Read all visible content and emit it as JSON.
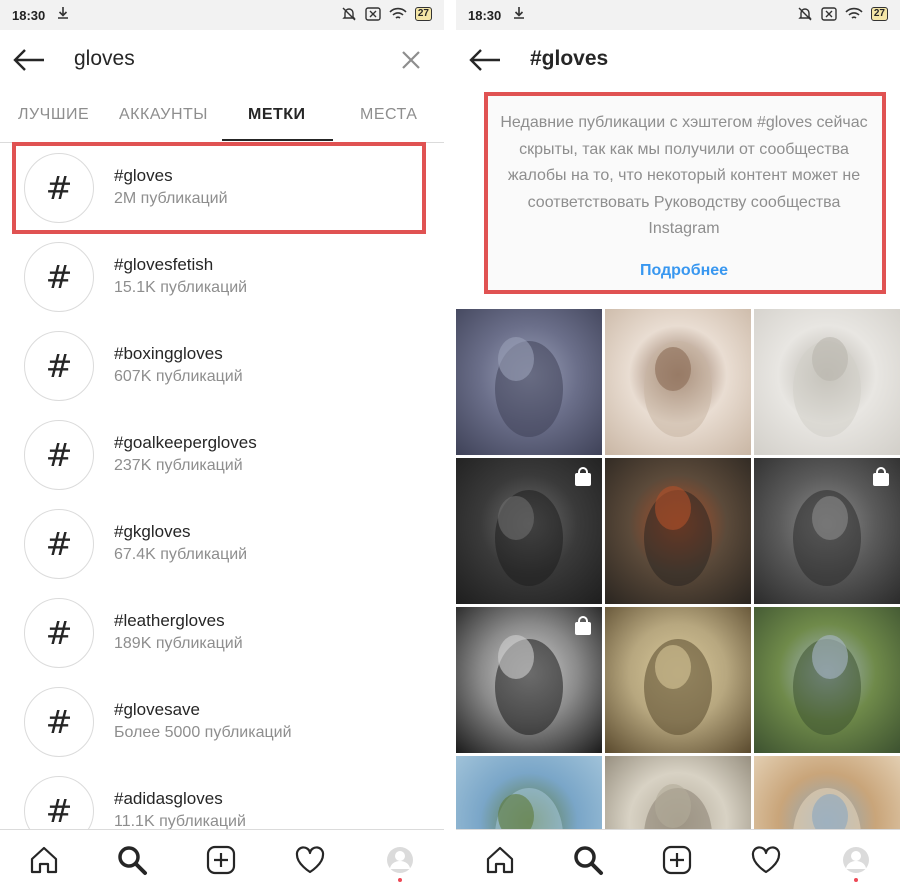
{
  "status_bar": {
    "time": "18:30",
    "battery": "27"
  },
  "left": {
    "search_query": "gloves",
    "tabs": [
      "ЛУЧШИЕ",
      "АККАУНТЫ",
      "МЕТКИ",
      "МЕСТА"
    ],
    "active_tab": "МЕТКИ",
    "results": [
      {
        "tag": "#gloves",
        "count": "2M публикаций"
      },
      {
        "tag": "#glovesfetish",
        "count": "15.1K публикаций"
      },
      {
        "tag": "#boxinggloves",
        "count": "607K публикаций"
      },
      {
        "tag": "#goalkeepergloves",
        "count": "237K публикаций"
      },
      {
        "tag": "#gkgloves",
        "count": "67.4K публикаций"
      },
      {
        "tag": "#leathergloves",
        "count": "189K публикаций"
      },
      {
        "tag": "#glovesave",
        "count": "Более 5000 публикаций"
      },
      {
        "tag": "#adidasgloves",
        "count": "11.1K публикаций"
      }
    ],
    "hash_symbol": "#"
  },
  "right": {
    "hashtag_title": "#gloves",
    "notice_text": "Недавние публикации с хэштегом #gloves сейчас скрыты, так как мы получили от сообщества жалобы на то, что некоторый контент может не соответствовать Руководству сообщества Instagram",
    "notice_link": "Подробнее",
    "grid_photos": [
      {
        "subject": "knitted-glove",
        "colors": [
          "#6b6f8a",
          "#3f4258",
          "#9aa0b8"
        ],
        "shopping": false
      },
      {
        "subject": "woman-gloves",
        "colors": [
          "#e9ddd2",
          "#c9b6a4",
          "#8a6a55"
        ],
        "shopping": false
      },
      {
        "subject": "white-glove",
        "colors": [
          "#e8e6e2",
          "#d2cfc9",
          "#b9b5ad"
        ],
        "shopping": false
      },
      {
        "subject": "moto-rider",
        "colors": [
          "#3a3a3a",
          "#1e1e1e",
          "#6e6e6e"
        ],
        "shopping": true
      },
      {
        "subject": "leather-gloves-bike",
        "colors": [
          "#5b4a3a",
          "#2a2520",
          "#b0502a"
        ],
        "shopping": false
      },
      {
        "subject": "black-glove",
        "colors": [
          "#5a5a5a",
          "#2b2b2b",
          "#8c8c8c"
        ],
        "shopping": true
      },
      {
        "subject": "goalkeeper-man",
        "colors": [
          "#8a8a8a",
          "#1a1a1a",
          "#d0d0d0"
        ],
        "shopping": true
      },
      {
        "subject": "woman-mask",
        "colors": [
          "#b7a77f",
          "#5a4a2e",
          "#d8c89a"
        ],
        "shopping": false
      },
      {
        "subject": "woman-blue-gloves",
        "colors": [
          "#6f8a4a",
          "#3d5230",
          "#a8b8c8"
        ],
        "shopping": false
      },
      {
        "subject": "landscape",
        "colors": [
          "#7aa6c8",
          "#a8c8dc",
          "#5d7a3a"
        ],
        "shopping": false
      },
      {
        "subject": "work-gloves",
        "colors": [
          "#d8d2c4",
          "#8a8272",
          "#b3ab9a"
        ],
        "shopping": false
      },
      {
        "subject": "woman-face-mask",
        "colors": [
          "#c9a57a",
          "#e8d7bd",
          "#8aa7bf"
        ],
        "shopping": false
      }
    ]
  },
  "nav": {
    "items": [
      "home-icon",
      "search-icon",
      "new-post-icon",
      "activity-icon",
      "profile-icon"
    ]
  },
  "colors": {
    "highlight_border": "#e05252",
    "link": "#3897f0",
    "secondary_text": "#8e8e8e"
  }
}
